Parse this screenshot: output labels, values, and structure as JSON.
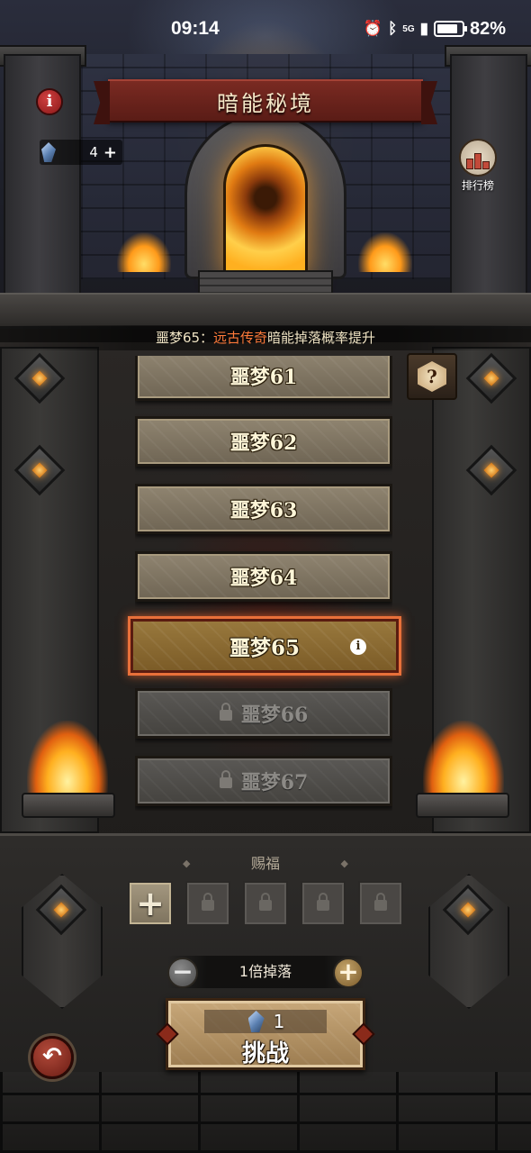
{
  "status_bar": {
    "time": "09:14",
    "battery": "82%",
    "network": "5G"
  },
  "header": {
    "title": "暗能秘境",
    "currency_count": "4",
    "ranking_label": "排行榜"
  },
  "bonus": {
    "prefix": "噩梦65：",
    "highlight": "远古传奇",
    "suffix": "暗能掉落概率提升",
    "highlight_color": "#ff7a3a"
  },
  "levels": [
    {
      "name": "噩梦61",
      "locked": false
    },
    {
      "name": "噩梦62",
      "locked": false
    },
    {
      "name": "噩梦63",
      "locked": false
    },
    {
      "name": "噩梦64",
      "locked": false
    },
    {
      "name": "噩梦65",
      "locked": false,
      "selected": true
    },
    {
      "name": "噩梦66",
      "locked": true
    },
    {
      "name": "噩梦67",
      "locked": true
    }
  ],
  "help_label": "?",
  "blessing": {
    "title": "赐福",
    "slots": [
      "add",
      "locked",
      "locked",
      "locked",
      "locked"
    ]
  },
  "multiplier": {
    "label": "1倍掉落"
  },
  "challenge": {
    "cost": "1",
    "label": "挑战"
  },
  "icons": {
    "info": "info-icon",
    "currency": "crystal-icon",
    "ranking": "podium-icon",
    "help": "question-icon",
    "lock": "lock-icon",
    "back": "back-arrow-icon"
  }
}
